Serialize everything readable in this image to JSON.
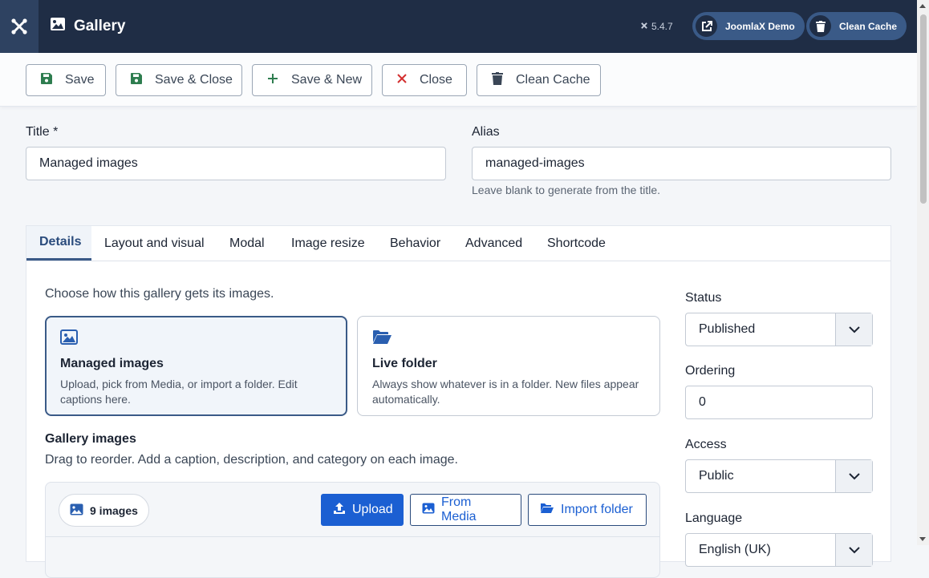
{
  "header": {
    "title": "Gallery",
    "version": "5.4.7",
    "site_button": "JoomlaX Demo",
    "cache_button": "Clean Cache"
  },
  "toolbar": {
    "save": "Save",
    "save_close": "Save & Close",
    "save_new": "Save & New",
    "close": "Close",
    "clean_cache": "Clean Cache"
  },
  "form": {
    "title_label": "Title *",
    "title_value": "Managed images",
    "alias_label": "Alias",
    "alias_value": "managed-images",
    "alias_hint": "Leave blank to generate from the title."
  },
  "tabs": [
    "Details",
    "Layout and visual",
    "Modal",
    "Image resize",
    "Behavior",
    "Advanced",
    "Shortcode"
  ],
  "details": {
    "choose_text": "Choose how this gallery gets its images.",
    "options": [
      {
        "title": "Managed images",
        "desc": "Upload, pick from Media, or import a folder. Edit captions here."
      },
      {
        "title": "Live folder",
        "desc": "Always show whatever is in a folder. New files appear automatically."
      }
    ],
    "gallery_images_title": "Gallery images",
    "gallery_images_desc": "Drag to reorder. Add a caption, description, and category on each image.",
    "image_count": "9 images",
    "upload": "Upload",
    "from_media": "From Media",
    "import_folder": "Import folder"
  },
  "sidebar": {
    "status_label": "Status",
    "status_value": "Published",
    "ordering_label": "Ordering",
    "ordering_value": "0",
    "access_label": "Access",
    "access_value": "Public",
    "language_label": "Language",
    "language_value": "English (UK)"
  },
  "colors": {
    "header_bg": "#1f2d45",
    "accent": "#3a5a87",
    "primary": "#1b5fd2",
    "close_red": "#d32f2f"
  }
}
